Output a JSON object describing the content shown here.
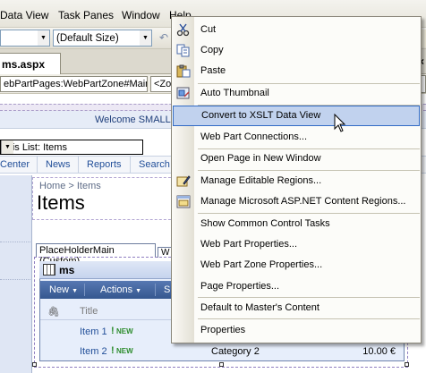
{
  "menubar": {
    "items": [
      "Data View",
      "Task Panes",
      "Window",
      "Help"
    ]
  },
  "toolbar": {
    "style_value": "",
    "size_value": "(Default Size)"
  },
  "document_tab": {
    "label": "ms.aspx"
  },
  "breadcrumbs": {
    "webpartzone": "ebPartPages:WebPartZone#Main>",
    "next": "<Zo"
  },
  "page": {
    "welcome": "Welcome SMALLB",
    "list_select": "This List: Items",
    "nav_items": [
      "Center",
      "News",
      "Reports",
      "Search"
    ],
    "breadcrumb": "Home > Items",
    "title": "Items"
  },
  "placeholder": {
    "tab_label": "PlaceHolderMain (Custom)",
    "second_tab": "W"
  },
  "webpart": {
    "title": "ms",
    "toolbar": [
      "New",
      "Actions",
      "S"
    ],
    "column_title": "Title",
    "rows": [
      {
        "title": "Item 1",
        "badge": "NEW",
        "category": "",
        "amount": ""
      },
      {
        "title": "Item 2",
        "badge": "NEW",
        "category": "Category 2",
        "amount": "10.00 €"
      }
    ]
  },
  "context_menu": {
    "items": [
      {
        "label": "Cut",
        "icon": "scissors-icon"
      },
      {
        "label": "Copy",
        "icon": "copy-icon"
      },
      {
        "label": "Paste",
        "icon": "paste-icon"
      },
      {
        "label": "Auto Thumbnail",
        "icon": "thumbnail-icon"
      },
      {
        "label": "Convert to XSLT Data View",
        "icon": ""
      },
      {
        "label": "Web Part Connections...",
        "icon": ""
      },
      {
        "label": "Open Page in New Window",
        "icon": ""
      },
      {
        "label": "Manage Editable Regions...",
        "icon": "editable-regions-icon"
      },
      {
        "label": "Manage Microsoft ASP.NET Content Regions...",
        "icon": "content-regions-icon"
      },
      {
        "label": "Show Common Control Tasks",
        "icon": ""
      },
      {
        "label": "Web Part Properties...",
        "icon": ""
      },
      {
        "label": "Web Part Zone Properties...",
        "icon": ""
      },
      {
        "label": "Page Properties...",
        "icon": ""
      },
      {
        "label": "Default to Master's Content",
        "icon": ""
      },
      {
        "label": "Properties",
        "icon": ""
      }
    ],
    "highlighted": "Convert to XSLT Data View"
  },
  "colors": {
    "menu_highlight": "#c1d2ee",
    "menu_highlight_border": "#316ac5",
    "link": "#224f99",
    "webpart_toolbar": "#35578f"
  }
}
